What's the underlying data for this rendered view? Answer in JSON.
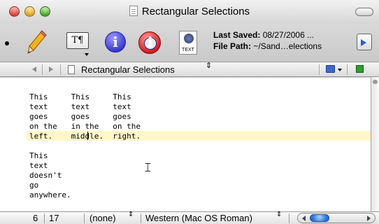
{
  "window": {
    "title": "Rectangular Selections"
  },
  "toolbar": {
    "items": [
      {
        "name": "bullet",
        "icon": "bullet-icon"
      },
      {
        "name": "pencil",
        "icon": "pencil-icon"
      },
      {
        "name": "text-options",
        "icon": "text-format-icon",
        "glyph": "T¶"
      },
      {
        "name": "get-info",
        "icon": "info-icon",
        "glyph": "i"
      },
      {
        "name": "globe-info",
        "icon": "globe-info-icon"
      },
      {
        "name": "text-encoding",
        "icon": "text-document-icon",
        "label": "TEXT"
      }
    ],
    "last_saved_label": "Last Saved:",
    "last_saved_value": "08/27/2006 ...",
    "file_path_label": "File Path:",
    "file_path_value": "~/Sand…elections"
  },
  "navbar": {
    "document_title": "Rectangular Selections",
    "updown_glyph": "⇕"
  },
  "editor": {
    "text": "This     This     This\ntext     text     text\ngoes     goes     goes\non the   in the   on the\nleft.    middle.  right.\n\nThis\ntext\ndoesn't\ngo\nanywhere.",
    "highlight_color": "#fff7c8"
  },
  "statusbar": {
    "line": "6",
    "column": "17",
    "language": "(none)",
    "encoding": "Western (Mac OS Roman)",
    "updown_glyph": "⇕"
  }
}
